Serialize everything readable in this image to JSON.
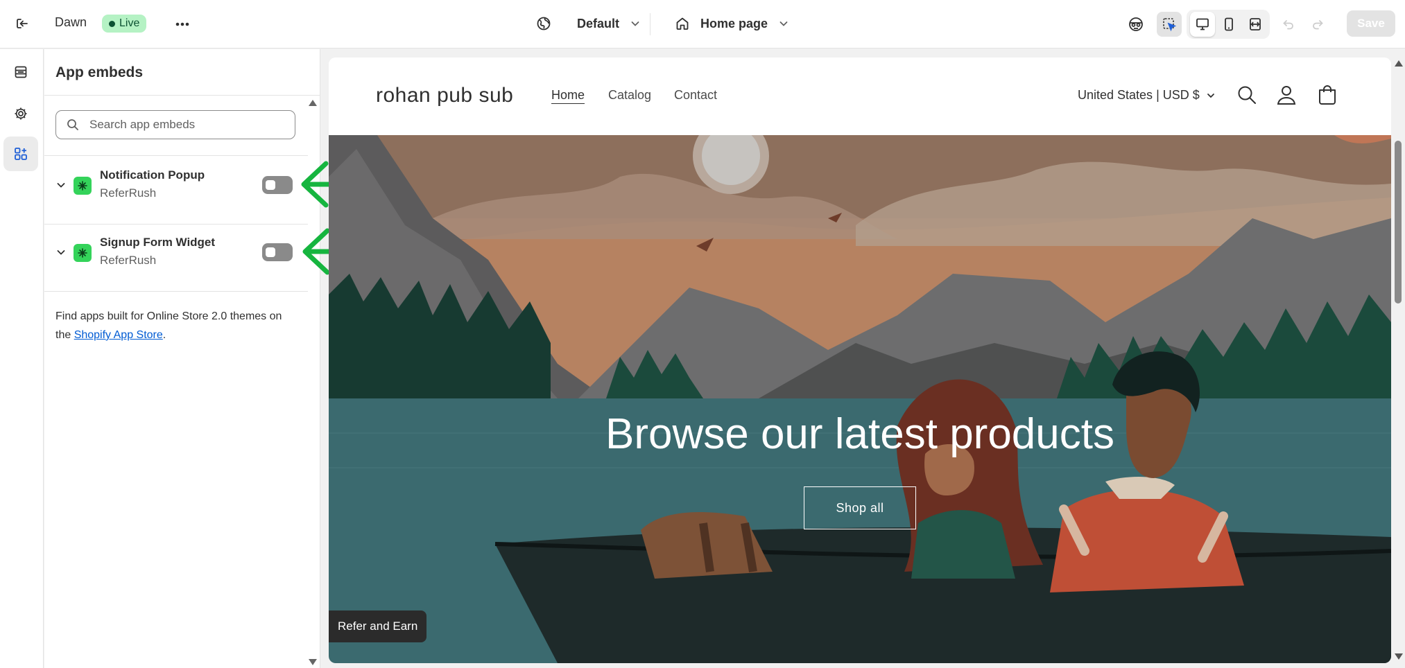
{
  "topbar": {
    "theme_name": "Dawn",
    "status_badge": "Live",
    "template_label": "Default",
    "page_label": "Home page",
    "save_label": "Save"
  },
  "panel": {
    "title": "App embeds",
    "search_placeholder": "Search app embeds",
    "embeds": [
      {
        "title": "Notification Popup",
        "app": "ReferRush",
        "enabled": false
      },
      {
        "title": "Signup Form Widget",
        "app": "ReferRush",
        "enabled": false
      }
    ],
    "footer_text_1": "Find apps built for Online Store 2.0 themes on the ",
    "footer_link": "Shopify App Store",
    "footer_text_2": "."
  },
  "store": {
    "logo": "rohan pub sub",
    "nav": [
      "Home",
      "Catalog",
      "Contact"
    ],
    "region": "United States | USD $",
    "hero_heading": "Browse our latest products",
    "hero_button": "Shop all",
    "refer_button": "Refer and Earn"
  },
  "colors": {
    "annotation_arrow": "#16b53f",
    "app_icon": "#34d35a",
    "live_badge_bg": "#b5f2c4"
  }
}
